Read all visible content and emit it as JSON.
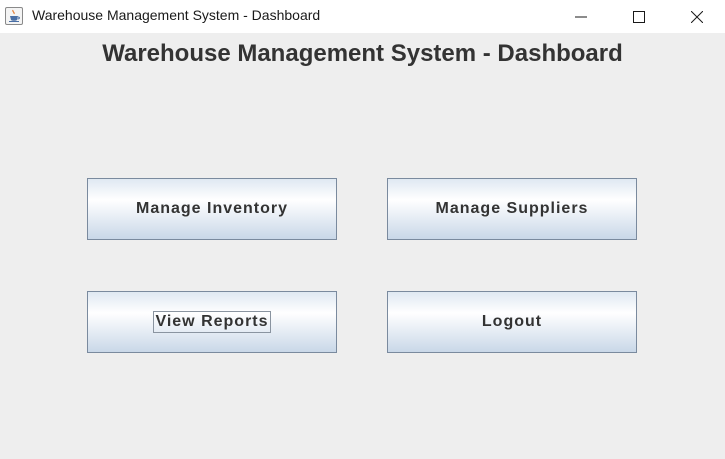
{
  "window": {
    "title": "Warehouse Management System - Dashboard",
    "icon": "java-cup-icon",
    "controls": [
      "minimize-icon",
      "maximize-icon",
      "close-icon"
    ]
  },
  "header": {
    "title": "Warehouse Management System - Dashboard"
  },
  "buttons": {
    "manage_inventory": "Manage Inventory",
    "manage_suppliers": "Manage Suppliers",
    "view_reports": "View Reports",
    "logout": "Logout"
  },
  "focused_button": "View Reports",
  "colors": {
    "background": "#eeeeee",
    "title_text": "#333333",
    "button_border": "#7a8a9e",
    "button_gradient_top": "#dfe8f2",
    "button_gradient_bottom": "#c9d8e8"
  }
}
